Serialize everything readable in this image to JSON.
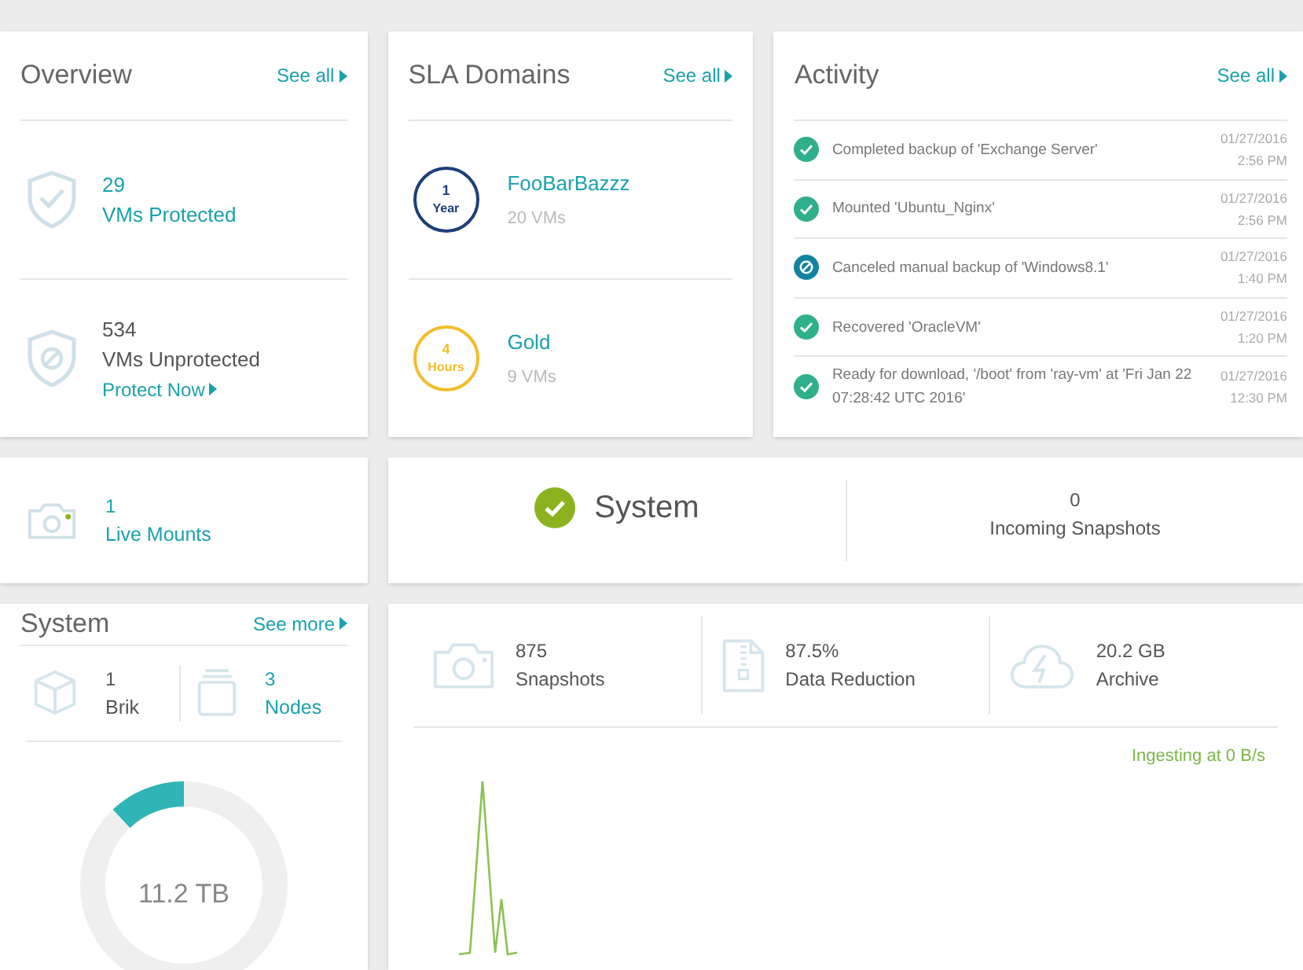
{
  "overview": {
    "title": "Overview",
    "link": "See all",
    "items": [
      {
        "kind": "protected",
        "count": "29",
        "label": "VMs Protected"
      },
      {
        "kind": "unprotected",
        "count": "534",
        "label": "VMs Unprotected",
        "action": "Protect Now"
      }
    ]
  },
  "sla_domains": {
    "title": "SLA Domains",
    "link": "See all",
    "items": [
      {
        "badge_number": "1",
        "badge_unit": "Year",
        "name": "FooBarBazzz",
        "vms": "20 VMs",
        "color": "#1d3f7a"
      },
      {
        "badge_number": "4",
        "badge_unit": "Hours",
        "name": "Gold",
        "vms": "9 VMs",
        "color": "#f3bd2b"
      }
    ]
  },
  "activity": {
    "title": "Activity",
    "link": "See all",
    "items": [
      {
        "kind": "success",
        "text": "Completed backup of 'Exchange Server'",
        "date": "01/27/2016",
        "time": "2:56 PM"
      },
      {
        "kind": "success",
        "text": "Mounted 'Ubuntu_Nginx'",
        "date": "01/27/2016",
        "time": "2:56 PM"
      },
      {
        "kind": "canceled",
        "text": "Canceled manual backup of 'Windows8.1'",
        "date": "01/27/2016",
        "time": "1:40 PM"
      },
      {
        "kind": "success",
        "text": "Recovered 'OracleVM'",
        "date": "01/27/2016",
        "time": "1:20 PM"
      },
      {
        "kind": "success",
        "text": "Ready for download, '/boot' from 'ray-vm' at 'Fri Jan 22 07:28:42 UTC 2016'",
        "date": "01/27/2016",
        "time": "12:30 PM"
      }
    ]
  },
  "live_mounts": {
    "count": "1",
    "label": "Live Mounts"
  },
  "system_status": {
    "label": "System",
    "healthy": true,
    "incoming_count": "0",
    "incoming_label": "Incoming Snapshots"
  },
  "system": {
    "title": "System",
    "link": "See more",
    "items": [
      {
        "kind": "brik",
        "count": "1",
        "label": "Brik",
        "link": false
      },
      {
        "kind": "nodes",
        "count": "3",
        "label": "Nodes",
        "link": true
      }
    ],
    "storage": {
      "level": 0.12,
      "label": "11.2 TB"
    }
  },
  "stats": [
    {
      "kind": "snapshots",
      "value": "875",
      "label": "Snapshots"
    },
    {
      "kind": "reduction",
      "value": "87.5%",
      "label": "Data Reduction"
    },
    {
      "kind": "archive",
      "value": "20.2 GB",
      "label": "Archive"
    }
  ],
  "ingest": {
    "label": "Ingesting at 0 B/s"
  }
}
